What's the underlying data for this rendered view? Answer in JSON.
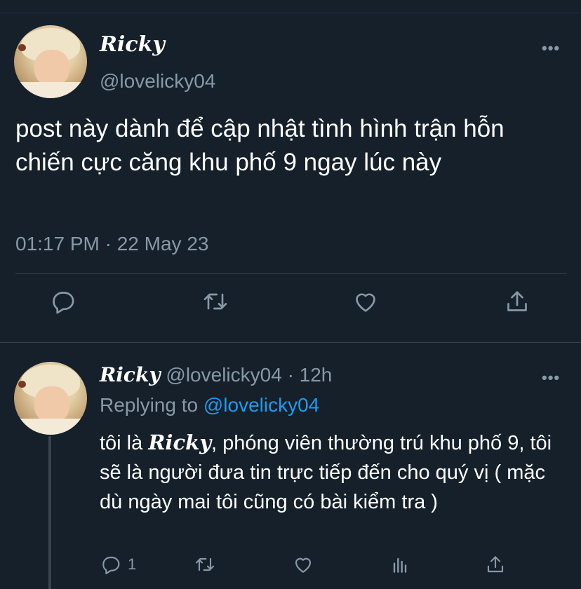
{
  "main_tweet": {
    "display_name": "Ricky",
    "handle": "@lovelicky04",
    "text": "post này dành để cập nhật tình hình trận hỗn chiến cực căng khu phố 9 ngay lúc này",
    "timestamp": "01:17 PM · 22 May 23",
    "more_icon": "more-horizontal-icon",
    "actions": [
      "reply-icon",
      "retweet-icon",
      "like-icon",
      "share-icon"
    ]
  },
  "reply_tweet": {
    "display_name": "Ricky",
    "handle": "@lovelicky04",
    "time_ago": "· 12h",
    "replying_label": "Replying to",
    "replying_to": "@lovelicky04",
    "text_before": "tôi là ",
    "text_name": "Ricky",
    "text_after": ", phóng viên thường trú khu phố 9, tôi sẽ là người đưa tin trực tiếp đến cho quý vị ( mặc dù ngày mai tôi cũng có bài kiểm tra )",
    "reply_count": "1",
    "actions": [
      "reply-icon",
      "retweet-icon",
      "like-icon",
      "analytics-icon",
      "share-icon"
    ]
  },
  "colors": {
    "background": "#15202b",
    "text": "#ffffff",
    "secondary": "#8899a6",
    "link": "#1d9bf0",
    "divider": "#38444d"
  }
}
